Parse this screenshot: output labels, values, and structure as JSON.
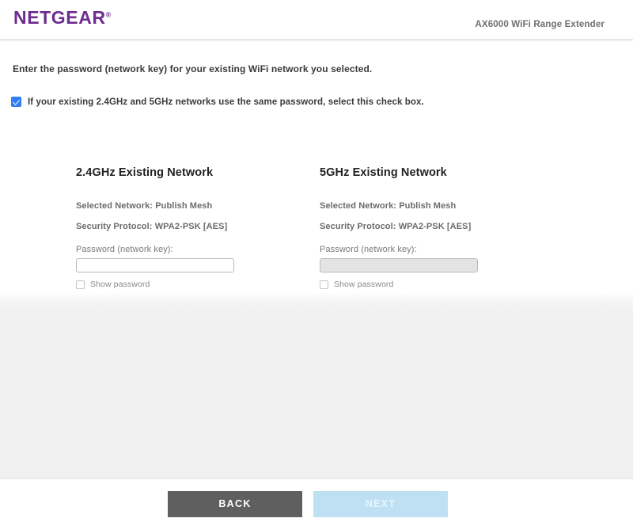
{
  "header": {
    "brand": "NETGEAR",
    "brand_reg": "®",
    "brand_color": "#6d2c8f",
    "product_name": "AX6000 WiFi Range Extender"
  },
  "instruction": "Enter the password (network key) for your existing WiFi network you selected.",
  "same_password_option": {
    "label": "If your existing 2.4GHz and 5GHz networks use the same password, select this check box.",
    "checked": true,
    "checkbox_color": "#2f7ef5"
  },
  "networks": [
    {
      "title": "2.4GHz Existing Network",
      "selected_network": "Selected Network: Publish Mesh",
      "security_protocol": "Security Protocol: WPA2-PSK [AES]",
      "password_label": "Password (network key):",
      "password_value": "",
      "password_placeholder": "",
      "password_disabled": false,
      "show_password_label": "Show password",
      "show_password_checked": false
    },
    {
      "title": "5GHz Existing Network",
      "selected_network": "Selected Network: Publish Mesh",
      "security_protocol": "Security Protocol: WPA2-PSK [AES]",
      "password_label": "Password (network key):",
      "password_value": "",
      "password_placeholder": "",
      "password_disabled": true,
      "show_password_label": "Show password",
      "show_password_checked": false
    }
  ],
  "footer": {
    "back_label": "BACK",
    "back_color": "#5f5f5f",
    "next_label": "NEXT",
    "next_color": "#bfe0f2",
    "next_disabled": true
  }
}
